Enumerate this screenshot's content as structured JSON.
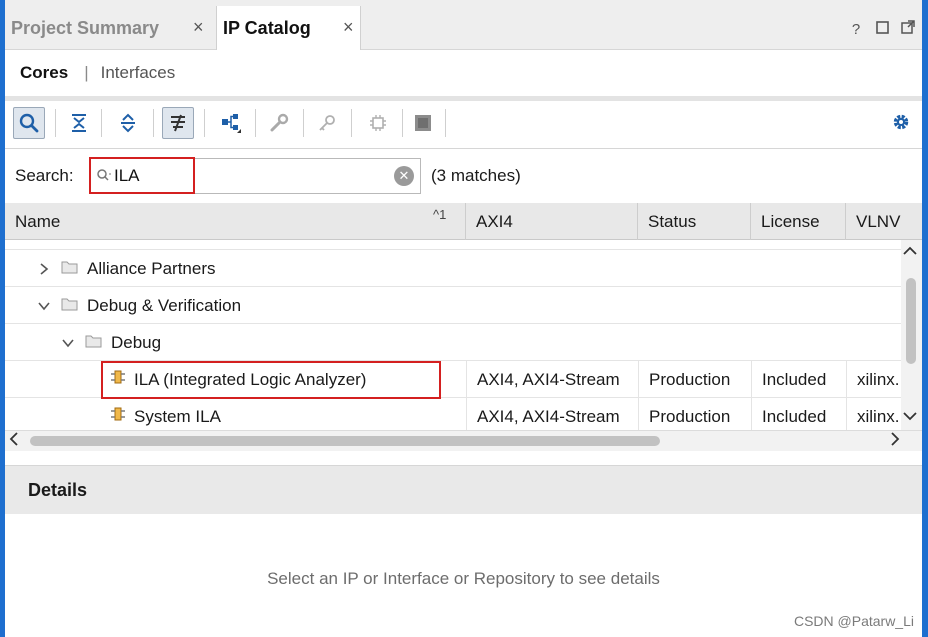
{
  "tabs": [
    {
      "label": "Project Summary",
      "close": "×",
      "active": false
    },
    {
      "label": "IP Catalog",
      "close": "×",
      "active": true
    }
  ],
  "window_controls": [
    "?",
    "□",
    "⧉"
  ],
  "subtabs": {
    "active": "Cores",
    "separator": "|",
    "inactive": "Interfaces"
  },
  "toolbar": {
    "buttons": [
      "search-icon",
      "collapse-all-icon",
      "expand-all-icon",
      "filter-icon",
      "hierarchy-icon",
      "wrench-icon",
      "key-icon",
      "chip-icon",
      "package-icon"
    ],
    "settings": "gear-icon",
    "accent": "#1e6fcf"
  },
  "search": {
    "label": "Search:",
    "value": "ILA",
    "matches": "(3 matches)"
  },
  "table": {
    "columns": [
      "Name",
      "AXI4",
      "Status",
      "License",
      "VLNV"
    ],
    "sort_indicator": "^1",
    "rows": [
      {
        "name": "Alliance Partners",
        "indent": 0,
        "type": "folder",
        "expanded": false,
        "axi": "",
        "status": "",
        "license": "",
        "vlnv": ""
      },
      {
        "name": "Debug & Verification",
        "indent": 0,
        "type": "folder",
        "expanded": true,
        "axi": "",
        "status": "",
        "license": "",
        "vlnv": ""
      },
      {
        "name": "Debug",
        "indent": 1,
        "type": "folder",
        "expanded": true,
        "axi": "",
        "status": "",
        "license": "",
        "vlnv": ""
      },
      {
        "name": "ILA (Integrated Logic Analyzer)",
        "indent": 2,
        "type": "ip",
        "axi": "AXI4, AXI4-Stream",
        "status": "Production",
        "license": "Included",
        "vlnv": "xilinx."
      },
      {
        "name": "System ILA",
        "indent": 2,
        "type": "ip",
        "axi": "AXI4, AXI4-Stream",
        "status": "Production",
        "license": "Included",
        "vlnv": "xilinx."
      }
    ]
  },
  "details": {
    "title": "Details",
    "message": "Select an IP or Interface or Repository to see details"
  },
  "watermark": "CSDN @Patarw_Li",
  "highlight_color": "#d42020"
}
